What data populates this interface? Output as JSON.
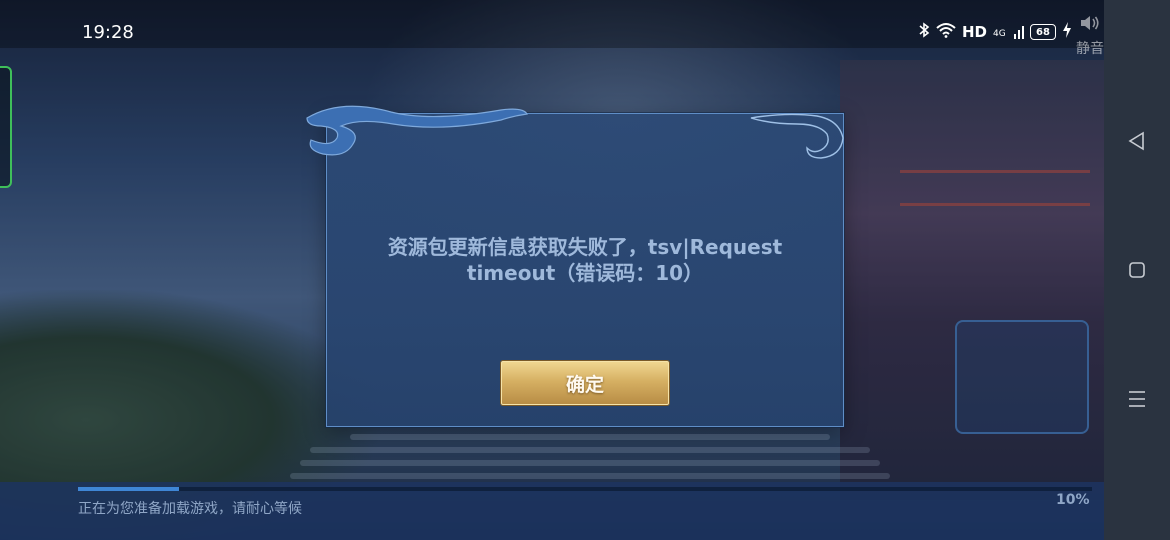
{
  "status_bar": {
    "time": "19:28",
    "hd_label": "HD",
    "network_label": "4G",
    "battery": "68",
    "mute_label": "静音"
  },
  "dialog": {
    "message_line1": "资源包更新信息获取失败了，tsv|Request",
    "message_line2": "timeout（错误码：10）",
    "ok_label": "确定"
  },
  "loading": {
    "text": "正在为您准备加载游戏，请耐心等候",
    "percent_label": "10%",
    "progress": 0.1
  },
  "colors": {
    "progress": "#3f86d6",
    "button_gold": "#d6b063",
    "dialog_border": "#5f8ec7"
  }
}
